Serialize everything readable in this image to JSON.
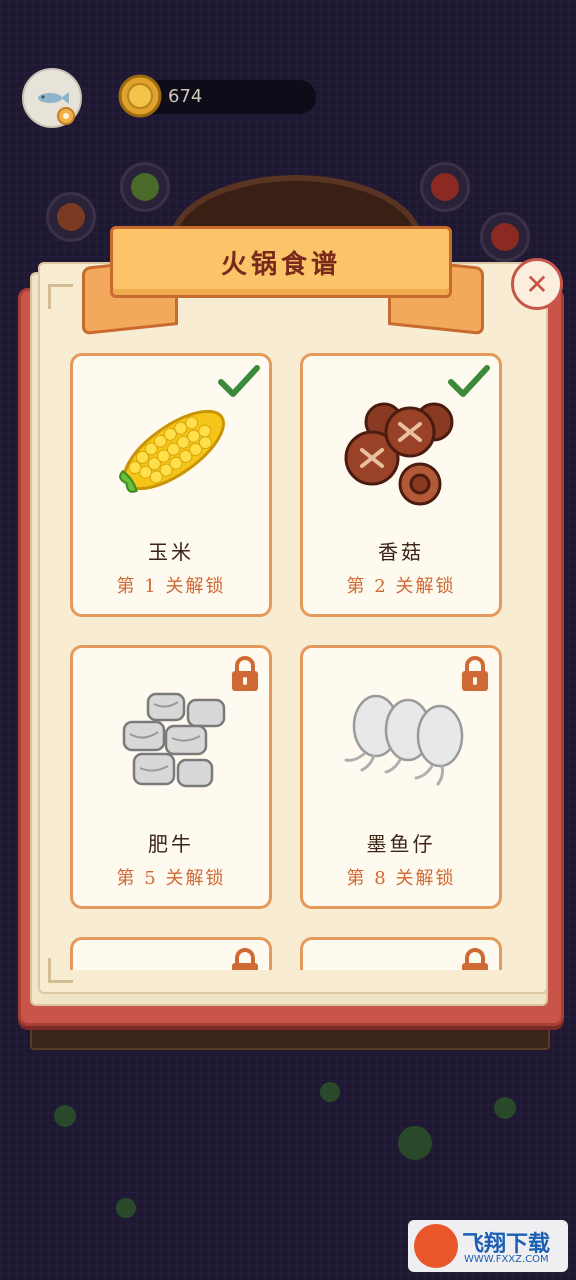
{
  "hud": {
    "coins": "674",
    "avatar_icon": "fish-icon",
    "coin_icon": "coin-icon"
  },
  "panel": {
    "title": "火锅食谱",
    "close_label": "✕"
  },
  "recipes": [
    {
      "name": "玉米",
      "unlock": "第 1 关解锁",
      "status": "unlocked",
      "icon": "corn-icon"
    },
    {
      "name": "香菇",
      "unlock": "第 2 关解锁",
      "status": "unlocked",
      "icon": "mushroom-icon"
    },
    {
      "name": "肥牛",
      "unlock": "第 5 关解锁",
      "status": "locked",
      "icon": "beef-roll-icon"
    },
    {
      "name": "墨鱼仔",
      "unlock": "第 8 关解锁",
      "status": "locked",
      "icon": "squid-icon"
    },
    {
      "name": "",
      "unlock": "",
      "status": "locked",
      "icon": "unknown-icon"
    },
    {
      "name": "",
      "unlock": "",
      "status": "locked",
      "icon": "unknown-icon"
    }
  ],
  "watermark": {
    "logo_text": "飞翔下载",
    "url_text": "WWW.FXXZ.COM"
  },
  "colors": {
    "accent": "#e49a5c",
    "check": "#3a8a3a",
    "lock": "#d06a34",
    "book": "#c9544a"
  }
}
